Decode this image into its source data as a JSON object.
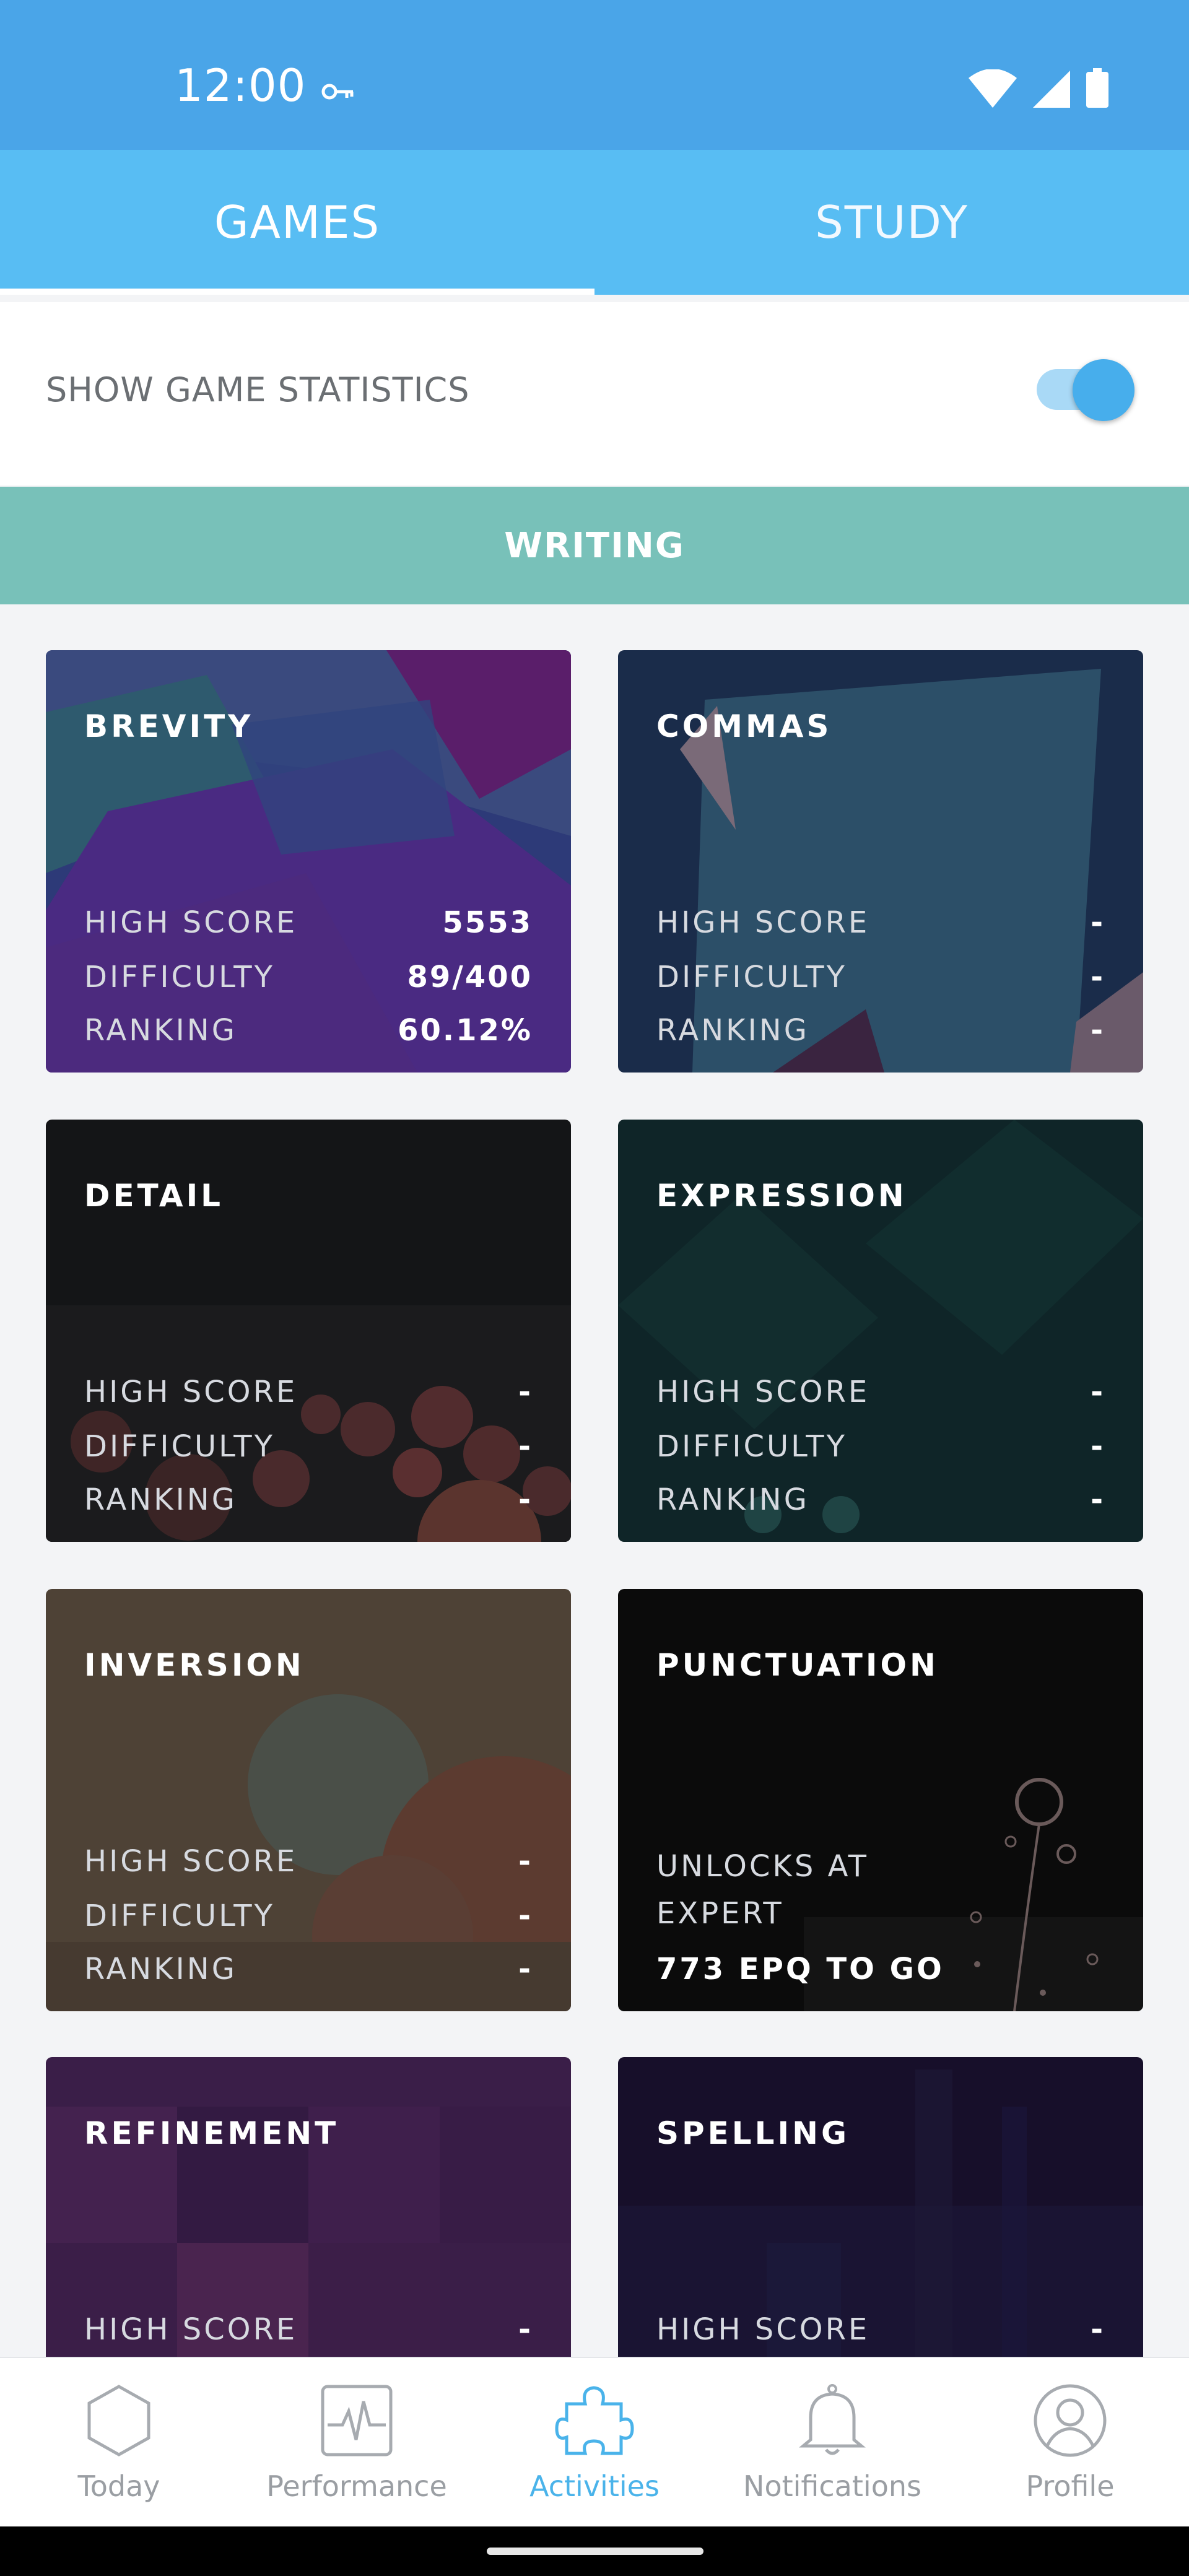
{
  "status_bar": {
    "time": "12:00"
  },
  "tabs": [
    {
      "label": "GAMES",
      "active": true
    },
    {
      "label": "STUDY",
      "active": false
    }
  ],
  "stats_toggle": {
    "label": "SHOW GAME STATISTICS",
    "on": true
  },
  "section": {
    "title": "WRITING"
  },
  "cards": [
    {
      "title": "BREVITY",
      "stats": [
        {
          "label": "HIGH SCORE",
          "value": "5553"
        },
        {
          "label": "DIFFICULTY",
          "value": "89/400"
        },
        {
          "label": "RANKING",
          "value": "60.12%"
        }
      ]
    },
    {
      "title": "COMMAS",
      "stats": [
        {
          "label": "HIGH SCORE",
          "value": "-"
        },
        {
          "label": "DIFFICULTY",
          "value": "-"
        },
        {
          "label": "RANKING",
          "value": "-"
        }
      ]
    },
    {
      "title": "DETAIL",
      "stats": [
        {
          "label": "HIGH SCORE",
          "value": "-"
        },
        {
          "label": "DIFFICULTY",
          "value": "-"
        },
        {
          "label": "RANKING",
          "value": "-"
        }
      ]
    },
    {
      "title": "EXPRESSION",
      "stats": [
        {
          "label": "HIGH SCORE",
          "value": "-"
        },
        {
          "label": "DIFFICULTY",
          "value": "-"
        },
        {
          "label": "RANKING",
          "value": "-"
        }
      ]
    },
    {
      "title": "INVERSION",
      "stats": [
        {
          "label": "HIGH SCORE",
          "value": "-"
        },
        {
          "label": "DIFFICULTY",
          "value": "-"
        },
        {
          "label": "RANKING",
          "value": "-"
        }
      ]
    },
    {
      "title": "PUNCTUATION",
      "locked": true,
      "unlock_line1": "UNLOCKS AT",
      "unlock_line2": "EXPERT",
      "unlock_amount": "773 EPQ TO GO"
    },
    {
      "title": "REFINEMENT",
      "stats": [
        {
          "label": "HIGH SCORE",
          "value": "-"
        }
      ]
    },
    {
      "title": "SPELLING",
      "stats": [
        {
          "label": "HIGH SCORE",
          "value": "-"
        }
      ]
    }
  ],
  "bottom_nav": [
    {
      "label": "Today",
      "icon": "hexagon-icon",
      "active": false
    },
    {
      "label": "Performance",
      "icon": "pulse-chart-icon",
      "active": false
    },
    {
      "label": "Activities",
      "icon": "puzzle-icon",
      "active": true
    },
    {
      "label": "Notifications",
      "icon": "bell-icon",
      "active": false
    },
    {
      "label": "Profile",
      "icon": "person-icon",
      "active": false
    }
  ],
  "colors": {
    "status_bar": "#4aa5e8",
    "tab_bar": "#58bdf3",
    "section": "#78c1b9",
    "accent": "#4ab3ea"
  }
}
